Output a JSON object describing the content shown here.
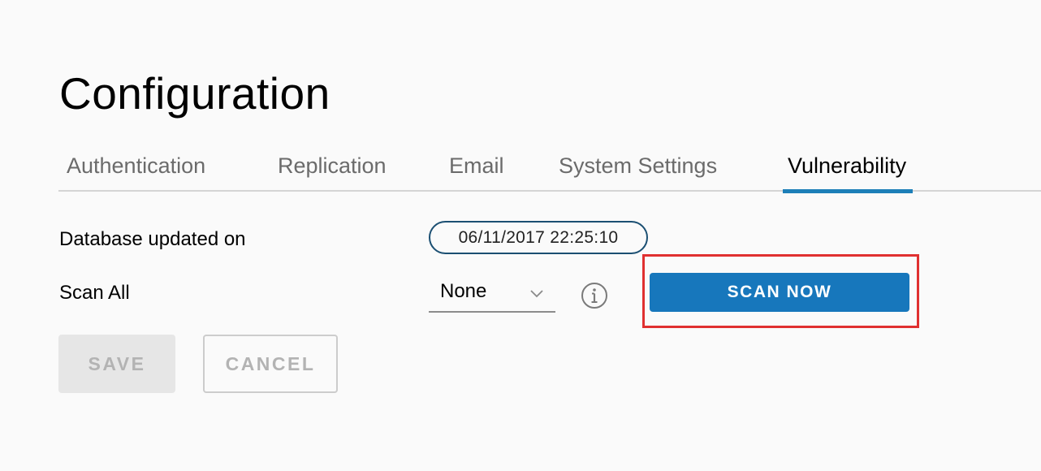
{
  "page": {
    "title": "Configuration"
  },
  "tabs": [
    {
      "label": "Authentication",
      "active": false
    },
    {
      "label": "Replication",
      "active": false
    },
    {
      "label": "Email",
      "active": false
    },
    {
      "label": "System Settings",
      "active": false
    },
    {
      "label": "Vulnerability",
      "active": true
    }
  ],
  "vulnerability": {
    "database_label": "Database updated on",
    "database_timestamp": "06/11/2017 22:25:10",
    "scan_all_label": "Scan All",
    "scan_all_selected": "None",
    "scan_now_label": "SCAN NOW"
  },
  "icons": {
    "dropdown": "chevron-down-icon",
    "info": "info-icon"
  },
  "actions": {
    "save_label": "SAVE",
    "cancel_label": "CANCEL"
  },
  "colors": {
    "accent": "#1777bc",
    "active_tab_underline": "#1d7fb8",
    "pill_border": "#1b4f72",
    "highlight": "#e03030",
    "disabled_text": "#b3b3b3"
  }
}
